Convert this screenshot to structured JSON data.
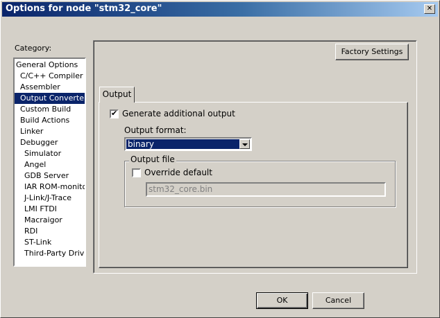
{
  "window": {
    "title": "Options for node \"stm32_core\"",
    "close_glyph": "✕"
  },
  "category": {
    "label": "Category:",
    "items": [
      {
        "label": "General Options"
      },
      {
        "label": "C/C++ Compiler"
      },
      {
        "label": "Assembler"
      },
      {
        "label": "Output Converter",
        "selected": true
      },
      {
        "label": "Custom Build"
      },
      {
        "label": "Build Actions"
      },
      {
        "label": "Linker"
      },
      {
        "label": "Debugger"
      },
      {
        "label": "Simulator"
      },
      {
        "label": "Angel"
      },
      {
        "label": "GDB Server"
      },
      {
        "label": "IAR ROM-monitor"
      },
      {
        "label": "J-Link/J-Trace"
      },
      {
        "label": "LMI FTDI"
      },
      {
        "label": "Macraigor"
      },
      {
        "label": "RDI"
      },
      {
        "label": "ST-Link"
      },
      {
        "label": "Third-Party Driver"
      }
    ]
  },
  "factory_settings_label": "Factory Settings",
  "tabs": [
    {
      "label": "Output",
      "active": true
    }
  ],
  "output": {
    "generate_checkbox_checked": true,
    "generate_label": "Generate additional output",
    "format_label": "Output format:",
    "format_value": "binary",
    "file_group_title": "Output file",
    "override_checked": false,
    "override_label": "Override default",
    "file_name": "stm32_core.bin"
  },
  "buttons": {
    "ok": "OK",
    "cancel": "Cancel"
  }
}
